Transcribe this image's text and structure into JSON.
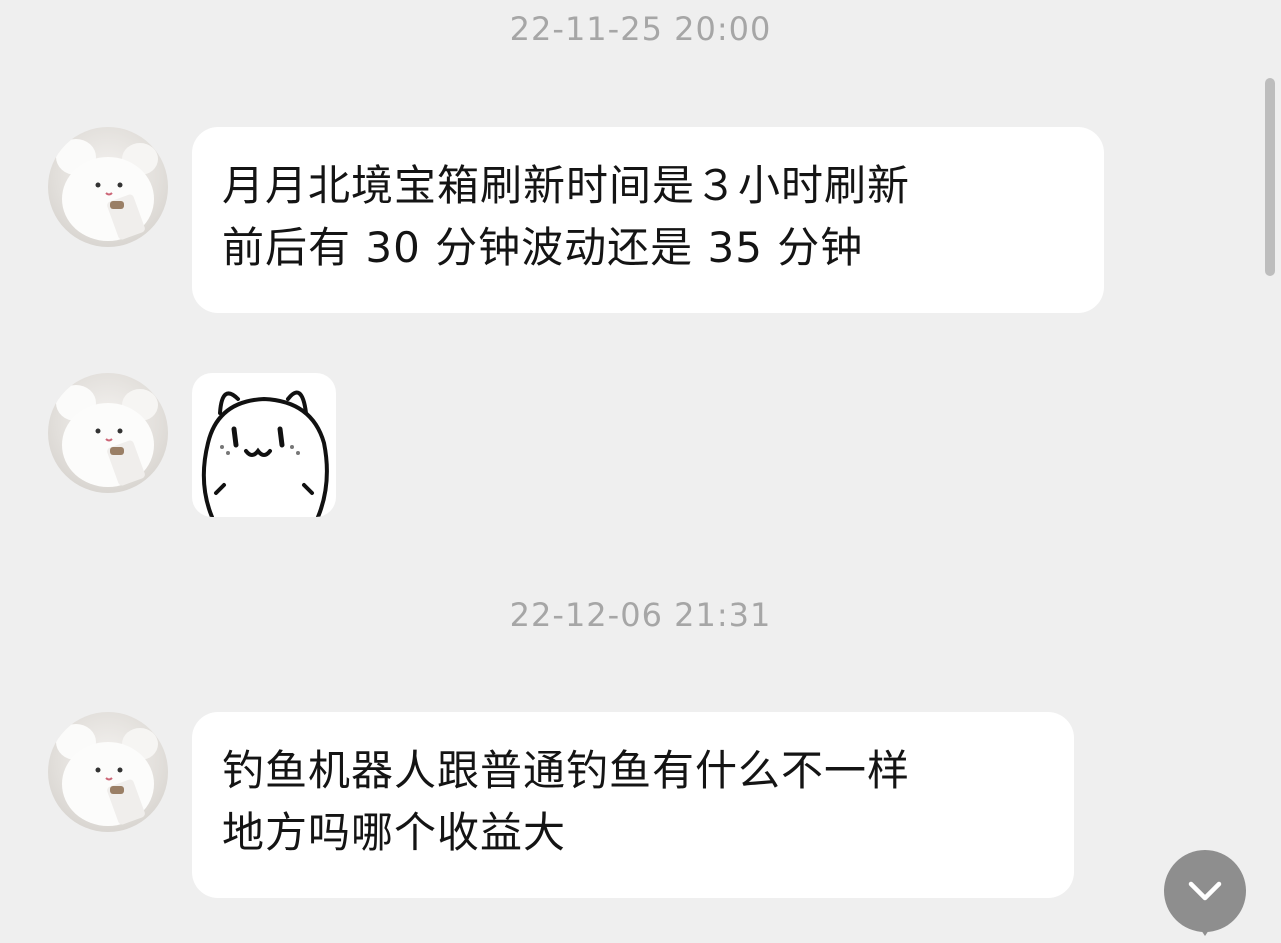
{
  "chat": {
    "timestamps": [
      "22-11-25 20:00",
      "22-12-06 21:31"
    ],
    "messages": [
      {
        "type": "text",
        "lines": [
          "月月北境宝箱刷新时间是３小时刷新",
          "前后有 30 分钟波动还是 35 分钟"
        ]
      },
      {
        "type": "sticker",
        "icon": "bear-face-sticker"
      },
      {
        "type": "text",
        "lines": [
          "钓鱼机器人跟普通钓鱼有什么不一样",
          "地方吗哪个收益大"
        ]
      }
    ]
  },
  "controls": {
    "scroll_down_icon": "chevron-down-icon",
    "scroll_button_color": "#8e8e8e"
  },
  "colors": {
    "background": "#efefef",
    "bubble": "#ffffff",
    "timestamp_text": "#a6a6a6",
    "message_text": "#141414"
  }
}
